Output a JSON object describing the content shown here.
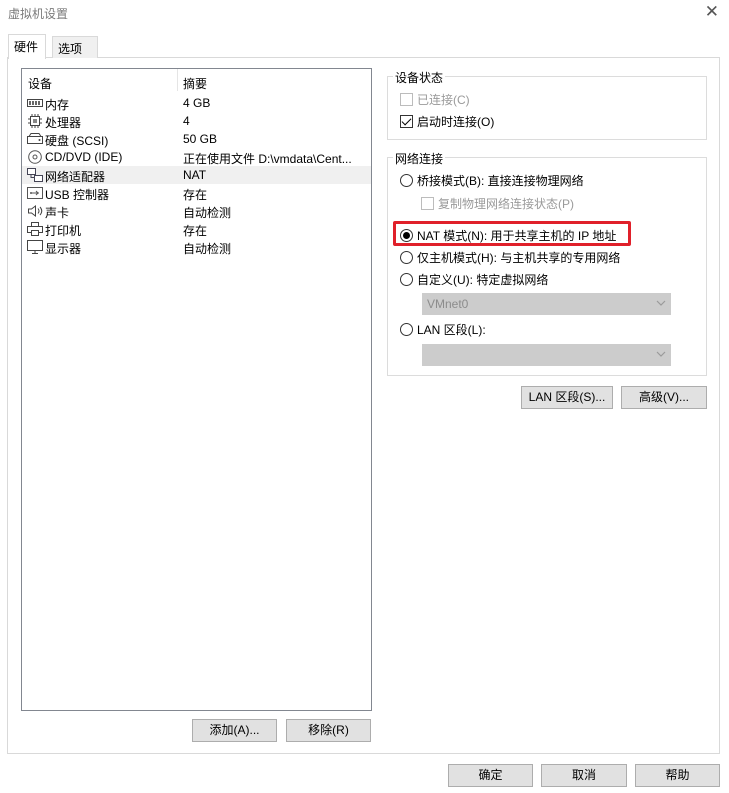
{
  "window": {
    "title": "虚拟机设置"
  },
  "tabs": [
    {
      "label": "硬件",
      "active": true
    },
    {
      "label": "选项",
      "active": false
    }
  ],
  "device_list": {
    "headers": {
      "device": "设备",
      "summary": "摘要"
    },
    "items": [
      {
        "name": "内存",
        "summary": "4 GB",
        "icon": "memory-icon",
        "selected": false
      },
      {
        "name": "处理器",
        "summary": "4",
        "icon": "processor-icon",
        "selected": false
      },
      {
        "name": "硬盘 (SCSI)",
        "summary": "50 GB",
        "icon": "hard-disk-icon",
        "selected": false
      },
      {
        "name": "CD/DVD (IDE)",
        "summary": "正在使用文件 D:\\vmdata\\Cent...",
        "icon": "cd-dvd-icon",
        "selected": false
      },
      {
        "name": "网络适配器",
        "summary": "NAT",
        "icon": "network-adapter-icon",
        "selected": true
      },
      {
        "name": "USB 控制器",
        "summary": "存在",
        "icon": "usb-icon",
        "selected": false
      },
      {
        "name": "声卡",
        "summary": "自动检测",
        "icon": "sound-card-icon",
        "selected": false
      },
      {
        "name": "打印机",
        "summary": "存在",
        "icon": "printer-icon",
        "selected": false
      },
      {
        "name": "显示器",
        "summary": "自动检测",
        "icon": "display-icon",
        "selected": false
      }
    ]
  },
  "device_buttons": {
    "add": "添加(A)...",
    "remove": "移除(R)"
  },
  "device_status": {
    "title": "设备状态",
    "connected": {
      "label": "已连接(C)",
      "checked": false,
      "disabled": true
    },
    "connect_at_power_on": {
      "label": "启动时连接(O)",
      "checked": true,
      "disabled": false
    }
  },
  "network_connection": {
    "title": "网络连接",
    "bridged": {
      "label": "桥接模式(B): 直接连接物理网络",
      "selected": false
    },
    "replicate": {
      "label": "复制物理网络连接状态(P)",
      "checked": false,
      "disabled": true
    },
    "nat": {
      "label": "NAT 模式(N): 用于共享主机的 IP 地址",
      "selected": true
    },
    "host_only": {
      "label": "仅主机模式(H): 与主机共享的专用网络",
      "selected": false
    },
    "custom": {
      "label": "自定义(U): 特定虚拟网络",
      "selected": false,
      "select_value": "VMnet0"
    },
    "lan_segment": {
      "label": "LAN 区段(L):",
      "selected": false,
      "select_value": ""
    }
  },
  "network_buttons": {
    "lan_segments": "LAN 区段(S)...",
    "advanced": "高级(V)..."
  },
  "footer_buttons": {
    "ok": "确定",
    "cancel": "取消",
    "help": "帮助"
  },
  "colors": {
    "highlight_border": "#e0202a",
    "selected_row": "#f0f0f0",
    "disabled_text": "#9a9a9a"
  }
}
